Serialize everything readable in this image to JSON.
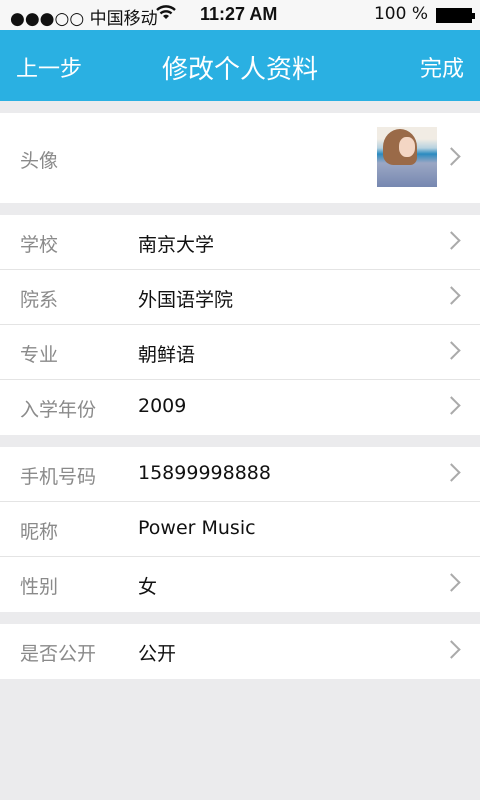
{
  "status_bar": {
    "carrier": "●●●○○ 中国移动",
    "wifi_icon": "wifi-icon",
    "time": "11:27 AM",
    "battery": "100 %"
  },
  "nav": {
    "back_label": "上一步",
    "title": "修改个人资料",
    "done_label": "完成",
    "color": "#2ab0e2"
  },
  "profile": {
    "avatar_label": "头像",
    "school": {
      "label": "学校",
      "value": "南京大学"
    },
    "department": {
      "label": "院系",
      "value": "外国语学院"
    },
    "major": {
      "label": "专业",
      "value": "朝鲜语"
    },
    "enroll_year": {
      "label": "入学年份",
      "value": "2009"
    },
    "phone": {
      "label": "手机号码",
      "value": "15899998888"
    },
    "nickname": {
      "label": "昵称",
      "value": "Power Music"
    },
    "gender": {
      "label": "性别",
      "value": "女"
    },
    "public": {
      "label": "是否公开",
      "value": "公开"
    }
  }
}
